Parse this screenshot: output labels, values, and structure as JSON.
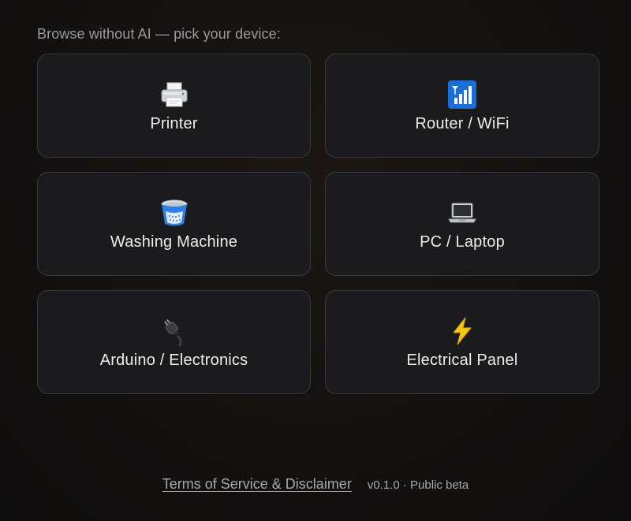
{
  "prompt": "Browse without AI — pick your device:",
  "devices": [
    {
      "label": "Printer",
      "icon": "printer-icon"
    },
    {
      "label": "Router / WiFi",
      "icon": "signal-bars-icon"
    },
    {
      "label": "Washing Machine",
      "icon": "washing-machine-icon"
    },
    {
      "label": "PC / Laptop",
      "icon": "laptop-icon"
    },
    {
      "label": "Arduino / Electronics",
      "icon": "electric-plug-icon"
    },
    {
      "label": "Electrical Panel",
      "icon": "lightning-bolt-icon"
    }
  ],
  "footer": {
    "terms_link": "Terms of Service & Disclaimer",
    "version": "v0.1.0 · Public beta"
  },
  "colors": {
    "background": "#141110",
    "card_background": "#1b1b1d",
    "card_border": "#3a3a3e",
    "accent_blue": "#1a6fd6",
    "bolt_yellow": "#f5c518"
  }
}
